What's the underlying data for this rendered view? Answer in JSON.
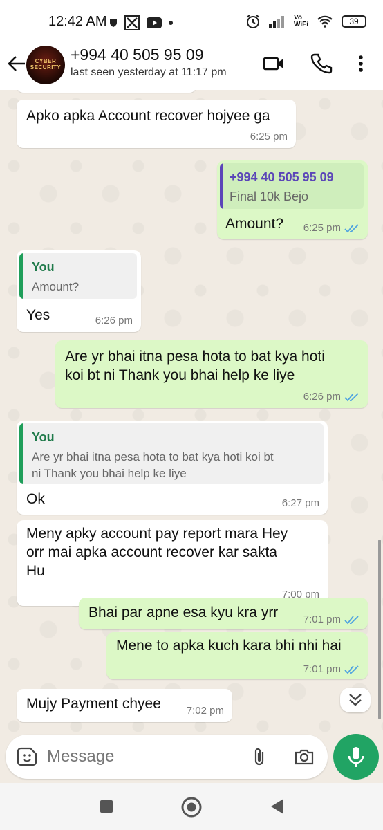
{
  "status_bar": {
    "time": "12:42 AM",
    "battery": "39",
    "network_label_top": "Vo",
    "network_label_bottom": "WiFi"
  },
  "header": {
    "contact_name": "+994 40 505 95 09",
    "last_seen": "last seen yesterday at 11:17 pm",
    "avatar_text": "CYBER SECURITY"
  },
  "messages": [
    {
      "text": "Apko apka Account recover hojyee ga",
      "time": "6:25 pm"
    },
    {
      "quote_author": "+994 40 505 95 09",
      "quote_text": "Final 10k   Bejo",
      "text": "Amount?",
      "time": "6:25 pm"
    },
    {
      "quote_author": "You",
      "quote_text": "Amount?",
      "text": "Yes",
      "time": "6:26 pm"
    },
    {
      "text_line1": "Are yr bhai itna pesa hota to bat kya hoti",
      "text_line2": "koi bt ni Thank you bhai help ke liye",
      "time": "6:26 pm"
    },
    {
      "quote_author": "You",
      "quote_line1": "Are yr bhai itna pesa hota to bat kya hoti koi bt",
      "quote_line2": "ni Thank you bhai help ke liye",
      "text": "Ok",
      "time": "6:27 pm"
    },
    {
      "text_line1": "Meny apky account pay report mara Hey",
      "text_line2": "orr mai apka account recover kar sakta",
      "text_line3": "Hu",
      "time": "7:00 pm"
    },
    {
      "text": "Bhai par apne esa kyu kra yrr",
      "time": "7:01 pm"
    },
    {
      "text": "Mene to apka kuch kara bhi nhi hai",
      "time": "7:01 pm"
    },
    {
      "text": "Mujy Payment chyee",
      "time": "7:02 pm"
    }
  ],
  "composer": {
    "placeholder": "Message"
  },
  "colors": {
    "outgoing_bubble": "#dcf8c6",
    "incoming_bubble": "#ffffff",
    "accent_green": "#21a464",
    "read_tick_blue": "#4fa3e0",
    "quote_green": "#1f9e5a",
    "quote_purple": "#5b46b8"
  },
  "icons": [
    "back-arrow-icon",
    "video-call-icon",
    "phone-icon",
    "more-options-icon",
    "emoji-sticker-icon",
    "attach-icon",
    "camera-icon",
    "mic-icon",
    "scroll-down-icon",
    "read-ticks-icon"
  ]
}
